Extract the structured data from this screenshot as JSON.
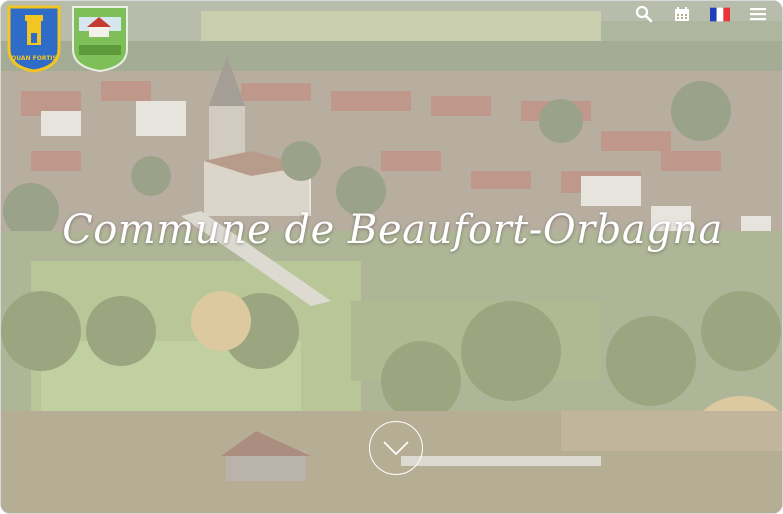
{
  "site": {
    "title": "Commune de Beaufort-Orbagna",
    "logos": [
      {
        "name": "beaufort-crest",
        "text": "QUAN FORTIS"
      },
      {
        "name": "orbagna-crest",
        "text": ""
      }
    ]
  },
  "topbar": {
    "icons": [
      "search-icon",
      "calendar-icon",
      "french-flag-icon",
      "menu-icon"
    ]
  },
  "colors": {
    "title": "#ffffff",
    "flag_blue": "#1f3fbf",
    "flag_red": "#e8343a",
    "crest_blue": "#2f6cc8",
    "crest_gold": "#f2c522"
  }
}
